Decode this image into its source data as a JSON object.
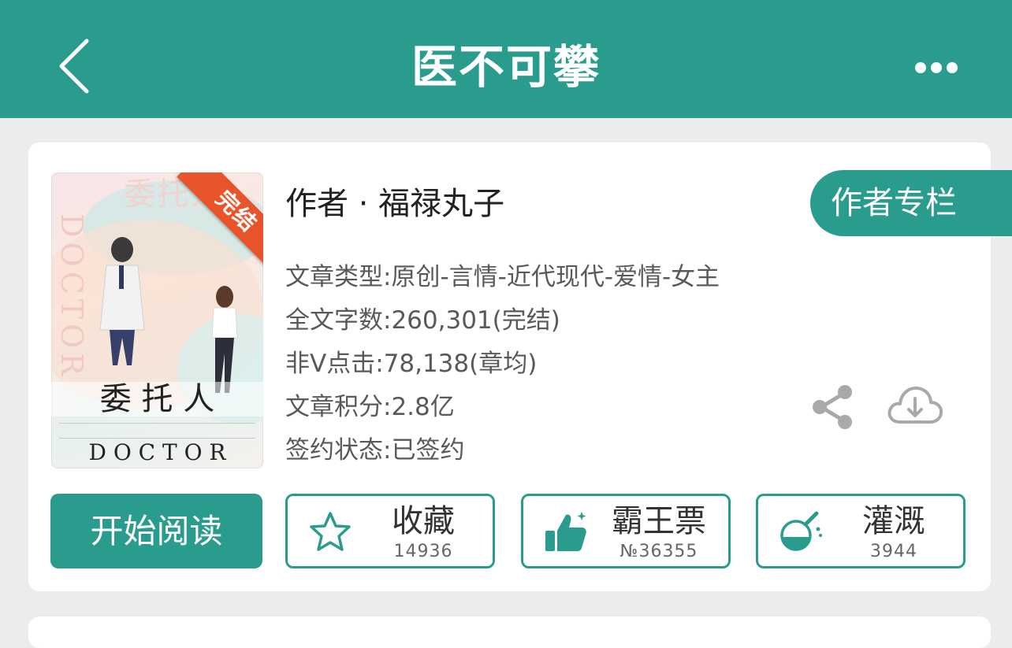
{
  "header": {
    "title": "医不可攀",
    "back_icon": "chevron-left-icon",
    "more_icon": "more-dots-icon"
  },
  "book": {
    "cover": {
      "badge": "完结",
      "title_top": "委托人",
      "title_big": "委 托 人",
      "side_text": "DOCTOR",
      "bottom_text": "D O C T O R"
    },
    "author_line": "作者 · 福禄丸子",
    "author_column_button": "作者专栏",
    "info": [
      "文章类型:原创-言情-近代现代-爱情-女主",
      "全文字数:260,301(完结)",
      "非V点击:78,138(章均)",
      "文章积分:2.8亿",
      "签约状态:已签约"
    ],
    "share_icon": "share-icon",
    "download_icon": "cloud-download-icon"
  },
  "actions": {
    "read": "开始阅读",
    "favorite": {
      "label": "收藏",
      "count": "14936",
      "icon": "star-icon"
    },
    "vote": {
      "label": "霸王票",
      "count": "№36355",
      "icon": "thumbs-up-icon"
    },
    "nutrient": {
      "label": "灌溉",
      "count": "3944",
      "icon": "flask-icon"
    }
  },
  "colors": {
    "accent": "#2a9c8d",
    "background": "#ececec",
    "badge": "#e8542b"
  }
}
